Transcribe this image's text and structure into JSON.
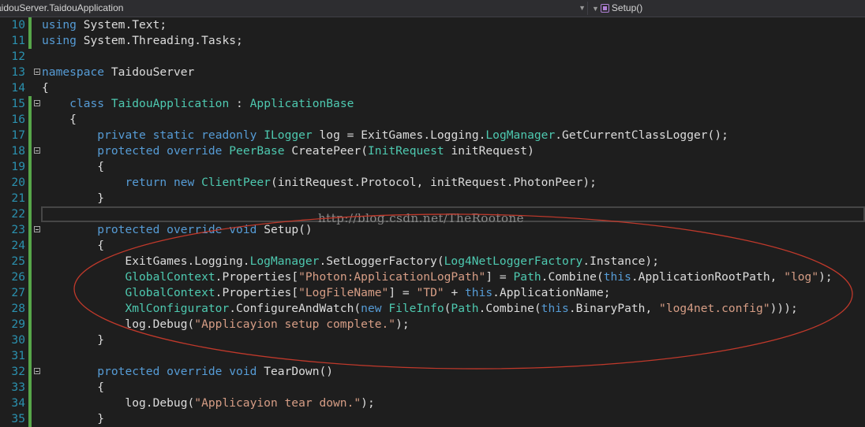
{
  "navbar": {
    "class_path": "aidouServer.TaidouApplication",
    "member": "Setup()",
    "member_icon": "method-icon"
  },
  "colors": {
    "background": "#1e1e1e",
    "keyword": "#569cd6",
    "type": "#4ec9b0",
    "string": "#d69d85",
    "text": "#dcdcdc",
    "line_number": "#2b91af",
    "changed_bar": "#57a64a",
    "annotation_ellipse": "#c0392b"
  },
  "watermark": "http://blog.csdn.net/TheRootone",
  "lines": [
    {
      "n": "10",
      "bar": "green",
      "fold": false,
      "cur": false,
      "tokens": [
        [
          "kw",
          "using"
        ],
        [
          "pl",
          " System.Text;"
        ]
      ]
    },
    {
      "n": "11",
      "bar": "green",
      "fold": false,
      "cur": false,
      "tokens": [
        [
          "kw",
          "using"
        ],
        [
          "pl",
          " System.Threading.Tasks;"
        ]
      ]
    },
    {
      "n": "12",
      "bar": "",
      "fold": false,
      "cur": false,
      "tokens": []
    },
    {
      "n": "13",
      "bar": "",
      "fold": true,
      "cur": false,
      "tokens": [
        [
          "kw",
          "namespace"
        ],
        [
          "pl",
          " TaidouServer"
        ]
      ]
    },
    {
      "n": "14",
      "bar": "",
      "fold": false,
      "cur": false,
      "tokens": [
        [
          "pl",
          "{"
        ]
      ]
    },
    {
      "n": "15",
      "bar": "green",
      "fold": true,
      "cur": false,
      "tokens": [
        [
          "pl",
          "    "
        ],
        [
          "kw",
          "class"
        ],
        [
          "pl",
          " "
        ],
        [
          "ty",
          "TaidouApplication"
        ],
        [
          "pl",
          " : "
        ],
        [
          "ty",
          "ApplicationBase"
        ]
      ]
    },
    {
      "n": "16",
      "bar": "green",
      "fold": false,
      "cur": false,
      "tokens": [
        [
          "pl",
          "    {"
        ]
      ]
    },
    {
      "n": "17",
      "bar": "green",
      "fold": false,
      "cur": false,
      "tokens": [
        [
          "pl",
          "        "
        ],
        [
          "kw",
          "private"
        ],
        [
          "pl",
          " "
        ],
        [
          "kw",
          "static"
        ],
        [
          "pl",
          " "
        ],
        [
          "kw",
          "readonly"
        ],
        [
          "pl",
          " "
        ],
        [
          "ty",
          "ILogger"
        ],
        [
          "pl",
          " log = ExitGames.Logging."
        ],
        [
          "ty",
          "LogManager"
        ],
        [
          "pl",
          ".GetCurrentClassLogger();"
        ]
      ]
    },
    {
      "n": "18",
      "bar": "green",
      "fold": true,
      "cur": false,
      "tokens": [
        [
          "pl",
          "        "
        ],
        [
          "kw",
          "protected"
        ],
        [
          "pl",
          " "
        ],
        [
          "kw",
          "override"
        ],
        [
          "pl",
          " "
        ],
        [
          "ty",
          "PeerBase"
        ],
        [
          "pl",
          " CreatePeer("
        ],
        [
          "ty",
          "InitRequest"
        ],
        [
          "pl",
          " initRequest)"
        ]
      ]
    },
    {
      "n": "19",
      "bar": "green",
      "fold": false,
      "cur": false,
      "tokens": [
        [
          "pl",
          "        {"
        ]
      ]
    },
    {
      "n": "20",
      "bar": "green",
      "fold": false,
      "cur": false,
      "tokens": [
        [
          "pl",
          "            "
        ],
        [
          "kw",
          "return"
        ],
        [
          "pl",
          " "
        ],
        [
          "kw",
          "new"
        ],
        [
          "pl",
          " "
        ],
        [
          "ty",
          "ClientPeer"
        ],
        [
          "pl",
          "(initRequest.Protocol, initRequest.PhotonPeer);"
        ]
      ]
    },
    {
      "n": "21",
      "bar": "green",
      "fold": false,
      "cur": false,
      "tokens": [
        [
          "pl",
          "        }"
        ]
      ]
    },
    {
      "n": "22",
      "bar": "green",
      "fold": false,
      "cur": true,
      "tokens": []
    },
    {
      "n": "23",
      "bar": "green",
      "fold": true,
      "cur": false,
      "tokens": [
        [
          "pl",
          "        "
        ],
        [
          "kw",
          "protected"
        ],
        [
          "pl",
          " "
        ],
        [
          "kw",
          "override"
        ],
        [
          "pl",
          " "
        ],
        [
          "kw",
          "void"
        ],
        [
          "pl",
          " Setup()"
        ]
      ]
    },
    {
      "n": "24",
      "bar": "green",
      "fold": false,
      "cur": false,
      "tokens": [
        [
          "pl",
          "        {"
        ]
      ]
    },
    {
      "n": "25",
      "bar": "green",
      "fold": false,
      "cur": false,
      "tokens": [
        [
          "pl",
          "            ExitGames.Logging."
        ],
        [
          "ty",
          "LogManager"
        ],
        [
          "pl",
          ".SetLoggerFactory("
        ],
        [
          "ty",
          "Log4NetLoggerFactory"
        ],
        [
          "pl",
          ".Instance);"
        ]
      ]
    },
    {
      "n": "26",
      "bar": "green",
      "fold": false,
      "cur": false,
      "tokens": [
        [
          "pl",
          "            "
        ],
        [
          "ty",
          "GlobalContext"
        ],
        [
          "pl",
          ".Properties["
        ],
        [
          "st",
          "\"Photon:ApplicationLogPath\""
        ],
        [
          "pl",
          "] = "
        ],
        [
          "ty",
          "Path"
        ],
        [
          "pl",
          ".Combine("
        ],
        [
          "kw",
          "this"
        ],
        [
          "pl",
          ".ApplicationRootPath, "
        ],
        [
          "st",
          "\"log\""
        ],
        [
          "pl",
          ");"
        ]
      ]
    },
    {
      "n": "27",
      "bar": "green",
      "fold": false,
      "cur": false,
      "tokens": [
        [
          "pl",
          "            "
        ],
        [
          "ty",
          "GlobalContext"
        ],
        [
          "pl",
          ".Properties["
        ],
        [
          "st",
          "\"LogFileName\""
        ],
        [
          "pl",
          "] = "
        ],
        [
          "st",
          "\"TD\""
        ],
        [
          "pl",
          " + "
        ],
        [
          "kw",
          "this"
        ],
        [
          "pl",
          ".ApplicationName;"
        ]
      ]
    },
    {
      "n": "28",
      "bar": "green",
      "fold": false,
      "cur": false,
      "tokens": [
        [
          "pl",
          "            "
        ],
        [
          "ty",
          "XmlConfigurator"
        ],
        [
          "pl",
          ".ConfigureAndWatch("
        ],
        [
          "kw",
          "new"
        ],
        [
          "pl",
          " "
        ],
        [
          "ty",
          "FileInfo"
        ],
        [
          "pl",
          "("
        ],
        [
          "ty",
          "Path"
        ],
        [
          "pl",
          ".Combine("
        ],
        [
          "kw",
          "this"
        ],
        [
          "pl",
          ".BinaryPath, "
        ],
        [
          "st",
          "\"log4net.config\""
        ],
        [
          "pl",
          ")));"
        ]
      ]
    },
    {
      "n": "29",
      "bar": "green",
      "fold": false,
      "cur": false,
      "tokens": [
        [
          "pl",
          "            log.Debug("
        ],
        [
          "st",
          "\"Applicayion setup complete.\""
        ],
        [
          "pl",
          ");"
        ]
      ]
    },
    {
      "n": "30",
      "bar": "green",
      "fold": false,
      "cur": false,
      "tokens": [
        [
          "pl",
          "        }"
        ]
      ]
    },
    {
      "n": "31",
      "bar": "green",
      "fold": false,
      "cur": false,
      "tokens": []
    },
    {
      "n": "32",
      "bar": "green",
      "fold": true,
      "cur": false,
      "tokens": [
        [
          "pl",
          "        "
        ],
        [
          "kw",
          "protected"
        ],
        [
          "pl",
          " "
        ],
        [
          "kw",
          "override"
        ],
        [
          "pl",
          " "
        ],
        [
          "kw",
          "void"
        ],
        [
          "pl",
          " TearDown()"
        ]
      ]
    },
    {
      "n": "33",
      "bar": "green",
      "fold": false,
      "cur": false,
      "tokens": [
        [
          "pl",
          "        {"
        ]
      ]
    },
    {
      "n": "34",
      "bar": "green",
      "fold": false,
      "cur": false,
      "tokens": [
        [
          "pl",
          "            log.Debug("
        ],
        [
          "st",
          "\"Applicayion tear down.\""
        ],
        [
          "pl",
          ");"
        ]
      ]
    },
    {
      "n": "35",
      "bar": "green",
      "fold": false,
      "cur": false,
      "tokens": [
        [
          "pl",
          "        }"
        ]
      ]
    }
  ]
}
